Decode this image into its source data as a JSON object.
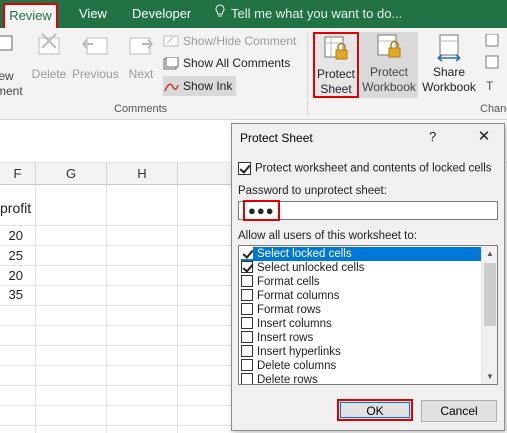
{
  "tabs": {
    "review": "Review",
    "view": "View",
    "developer": "Developer",
    "tell_me": "Tell me what you want to do..."
  },
  "ribbon": {
    "new_comment_part1": "ew",
    "new_comment_part2": "ment",
    "delete": "Delete",
    "previous": "Previous",
    "next": "Next",
    "show_hide_comment": "Show/Hide Comment",
    "show_all_comments": "Show All Comments",
    "show_ink": "Show Ink",
    "comments_group": "Comments",
    "protect_sheet_line1": "Protect",
    "protect_sheet_line2": "Sheet",
    "protect_workbook_line1": "Protect",
    "protect_workbook_line2": "Workbook",
    "share_workbook_line1": "Share",
    "share_workbook_line2": "Workbook",
    "changes_group": "Changes",
    "accent": "#217346",
    "highlight": "#e00000"
  },
  "sheet": {
    "columns": [
      "F",
      "G",
      "H"
    ],
    "header_cell": "profit",
    "values": [
      "20",
      "25",
      "20",
      "35"
    ]
  },
  "dialog": {
    "title": "Protect Sheet",
    "help": "?",
    "close": "✕",
    "protect_label": "Protect worksheet and contents of locked cells",
    "password_label": "Password to unprotect sheet:",
    "password_mask": "●●●",
    "allow_label": "Allow all users of this worksheet to:",
    "permissions": [
      {
        "label": "Select locked cells",
        "checked": true,
        "selected": true
      },
      {
        "label": "Select unlocked cells",
        "checked": true,
        "selected": false
      },
      {
        "label": "Format cells",
        "checked": false,
        "selected": false
      },
      {
        "label": "Format columns",
        "checked": false,
        "selected": false
      },
      {
        "label": "Format rows",
        "checked": false,
        "selected": false
      },
      {
        "label": "Insert columns",
        "checked": false,
        "selected": false
      },
      {
        "label": "Insert rows",
        "checked": false,
        "selected": false
      },
      {
        "label": "Insert hyperlinks",
        "checked": false,
        "selected": false
      },
      {
        "label": "Delete columns",
        "checked": false,
        "selected": false
      },
      {
        "label": "Delete rows",
        "checked": false,
        "selected": false
      }
    ],
    "ok": "OK",
    "cancel": "Cancel"
  }
}
